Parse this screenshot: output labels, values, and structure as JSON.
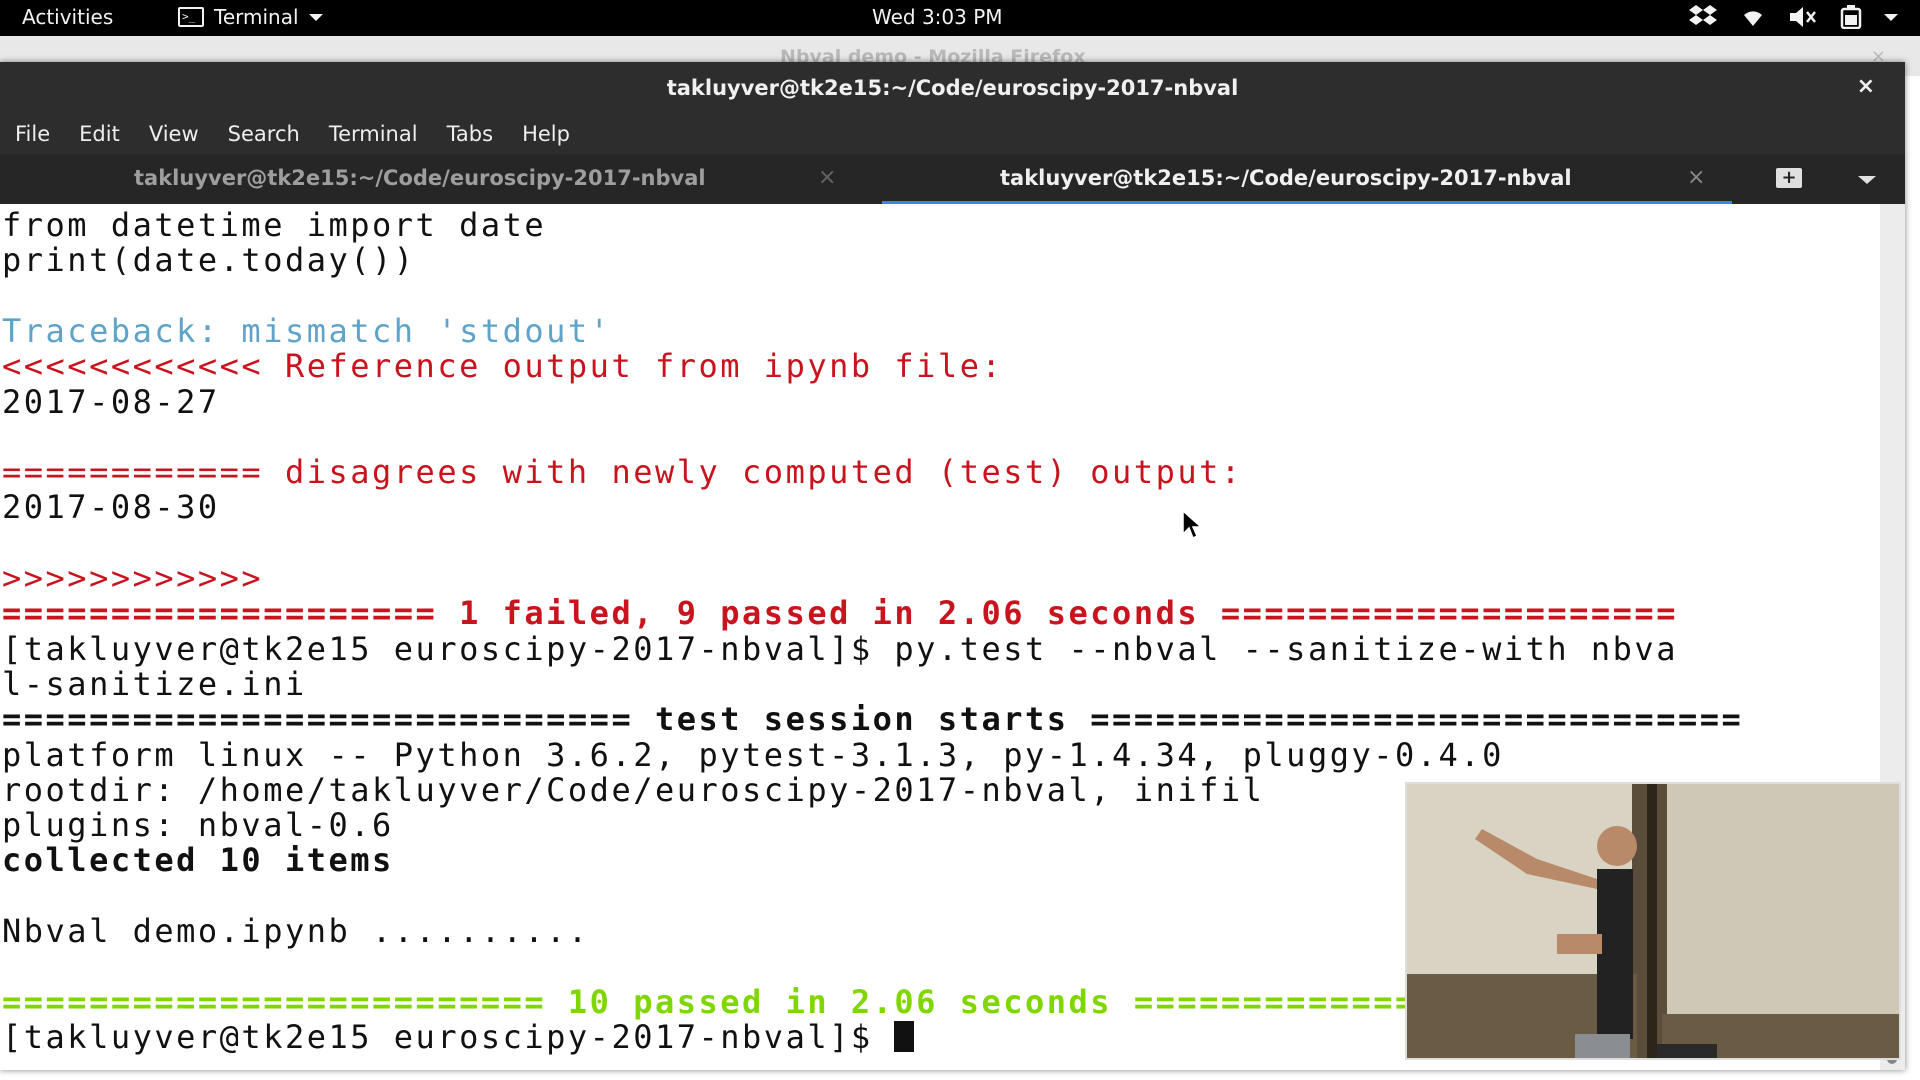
{
  "topbar": {
    "activities": "Activities",
    "app_name": "Terminal",
    "clock": "Wed  3:03 PM"
  },
  "background_window": {
    "title": "Nbval demo - Mozilla Firefox"
  },
  "window": {
    "title": "takluyver@tk2e15:~/Code/euroscipy-2017-nbval",
    "close_glyph": "×"
  },
  "menu": {
    "items": [
      "File",
      "Edit",
      "View",
      "Search",
      "Terminal",
      "Tabs",
      "Help"
    ]
  },
  "tabs": [
    {
      "label": "takluyver@tk2e15:~/Code/euroscipy-2017-nbval",
      "active": false
    },
    {
      "label": "takluyver@tk2e15:~/Code/euroscipy-2017-nbval",
      "active": true
    }
  ],
  "tab_close_glyph": "×",
  "terminal": {
    "lines": [
      {
        "text": "from datetime import date",
        "style": "normal"
      },
      {
        "text": "print(date.today())",
        "style": "normal"
      },
      {
        "text": "",
        "style": "normal"
      },
      {
        "text": "Traceback: mismatch 'stdout'",
        "style": "blue"
      },
      {
        "text": "<<<<<<<<<<<< Reference output from ipynb file:",
        "style": "red"
      },
      {
        "text": "2017-08-27",
        "style": "normal"
      },
      {
        "text": "",
        "style": "normal"
      },
      {
        "text": "============ disagrees with newly computed (test) output:",
        "style": "red"
      },
      {
        "text": "2017-08-30",
        "style": "normal"
      },
      {
        "text": "",
        "style": "normal"
      },
      {
        "text": ">>>>>>>>>>>>",
        "style": "red"
      },
      {
        "text": "==================== 1 failed, 9 passed in 2.06 seconds =====================",
        "style": "redb"
      },
      {
        "text": "[takluyver@tk2e15 euroscipy-2017-nbval]$ py.test --nbval --sanitize-with nbva",
        "style": "normal"
      },
      {
        "text": "l-sanitize.ini",
        "style": "normal"
      },
      {
        "text": "============================= test session starts ==============================",
        "style": "bold"
      },
      {
        "text": "platform linux -- Python 3.6.2, pytest-3.1.3, py-1.4.34, pluggy-0.4.0",
        "style": "normal"
      },
      {
        "text": "rootdir: /home/takluyver/Code/euroscipy-2017-nbval, inifil",
        "style": "normal"
      },
      {
        "text": "plugins: nbval-0.6",
        "style": "normal"
      },
      {
        "text": "collected 10 items",
        "style": "bold"
      },
      {
        "text": "",
        "style": "normal"
      },
      {
        "text": "Nbval demo.ipynb ..........",
        "style": "normal"
      },
      {
        "text": "",
        "style": "normal"
      },
      {
        "text": "========================= 10 passed in 2.06 seconds ==========================",
        "style": "green"
      },
      {
        "text": "[takluyver@tk2e15 euroscipy-2017-nbval]$ ",
        "style": "normal",
        "cursor": true
      }
    ]
  },
  "colors": {
    "error_red": "#c8141e",
    "traceback_blue": "#5fa3c8",
    "pass_green": "#7fd600",
    "tab_active_underline": "#3a87d9"
  },
  "icons": [
    "terminal-icon",
    "dropbox-icon",
    "wifi-icon",
    "volume-icon",
    "battery-icon",
    "new-tab-icon",
    "mouse-pointer-icon"
  ]
}
